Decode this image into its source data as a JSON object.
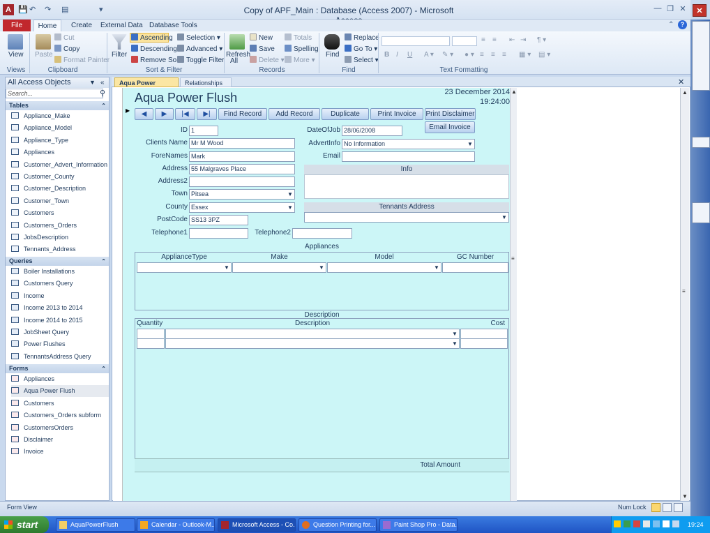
{
  "window": {
    "title": "Copy of APF_Main : Database (Access 2007) - Microsoft Access"
  },
  "ribbon": {
    "tabs": [
      "File",
      "Home",
      "Create",
      "External Data",
      "Database Tools"
    ],
    "views": {
      "view": "View",
      "label": "Views"
    },
    "clipboard": {
      "paste": "Paste",
      "cut": "Cut",
      "copy": "Copy",
      "format_painter": "Format Painter",
      "label": "Clipboard"
    },
    "sort": {
      "filter": "Filter",
      "ascending": "Ascending",
      "descending": "Descending",
      "remove_sort": "Remove Sort",
      "selection": "Selection",
      "advanced": "Advanced",
      "toggle_filter": "Toggle Filter",
      "label": "Sort & Filter"
    },
    "records": {
      "refresh": "Refresh",
      "refresh2": "All",
      "new": "New",
      "save": "Save",
      "delete": "Delete",
      "totals": "Totals",
      "spelling": "Spelling",
      "more": "More",
      "label": "Records"
    },
    "find": {
      "find": "Find",
      "replace": "Replace",
      "goto": "Go To",
      "select": "Select",
      "label": "Find"
    },
    "text": {
      "label": "Text Formatting"
    }
  },
  "nav": {
    "header": "All Access Objects",
    "search": "Search...",
    "sections": [
      {
        "title": "Tables",
        "items": [
          "Appliance_Make",
          "Appliance_Model",
          "Appliance_Type",
          "Appliances",
          "Customer_Advert_Information",
          "Customer_County",
          "Customer_Description",
          "Customer_Town",
          "Customers",
          "Customers_Orders",
          "JobsDescription",
          "Tennants_Address"
        ]
      },
      {
        "title": "Queries",
        "items": [
          "Boiler Installations",
          "Customers Query",
          "Income",
          "Income 2013 to 2014",
          "Income 2014 to 2015",
          "JobSheet Query",
          "Power Flushes",
          "TennantsAddress Query"
        ]
      },
      {
        "title": "Forms",
        "items": [
          "Appliances",
          "Aqua Power Flush",
          "Customers",
          "Customers_Orders subform",
          "CustomersOrders",
          "Disclaimer",
          "Invoice"
        ]
      }
    ]
  },
  "doc": {
    "tabs": [
      "Aqua Power Flush",
      "Relationships"
    ]
  },
  "form": {
    "title": "Aqua Power Flush",
    "date": "23 December 2014",
    "time": "19:24:00",
    "buttons": {
      "find": "Find Record",
      "add": "Add Record",
      "dup": "Duplicate",
      "print_inv": "Print Invoice",
      "print_disc": "Print Disclaimer",
      "email": "Email Invoice"
    },
    "labels": {
      "id": "ID",
      "clients": "Clients Name",
      "fore": "ForeNames",
      "address": "Address",
      "address2": "Address2",
      "town": "Town",
      "county": "County",
      "postcode": "PostCode",
      "tel1": "Telephone1",
      "tel2": "Telephone2",
      "dateofjob": "DateOfJob",
      "advert": "AdvertInfo",
      "email": "Email",
      "info": "Info",
      "tenants": "Tennants Address",
      "appliances": "Appliances",
      "description_sec": "Description",
      "total": "Total Amount"
    },
    "values": {
      "id": "1",
      "clients": "Mr M Wood",
      "fore": "Mark",
      "address": "55 Malgraves Place",
      "address2": "",
      "town": "Pitsea",
      "county": "Essex",
      "postcode": "SS13 3PZ",
      "tel1": "",
      "tel2": "",
      "dateofjob": "28/06/2008",
      "advert": "No Information",
      "email": ""
    },
    "appl_cols": [
      "ApplianceType",
      "Make",
      "Model",
      "GC Number"
    ],
    "desc_cols": [
      "Quantity",
      "Description",
      "Cost"
    ]
  },
  "status": {
    "left": "Form View",
    "numlock": "Num Lock"
  },
  "taskbar": {
    "start": "start",
    "items": [
      "AquaPowerFlush",
      "Calendar - Outlook-M...",
      "Microsoft Access - Co...",
      "Question Printing for...",
      "Paint Shop Pro - Data..."
    ],
    "clock": "19:24"
  },
  "colors": {
    "form_bg": "#ccf6f7",
    "file_tab": "#c1272d",
    "taskbar": "#2a66d8"
  }
}
